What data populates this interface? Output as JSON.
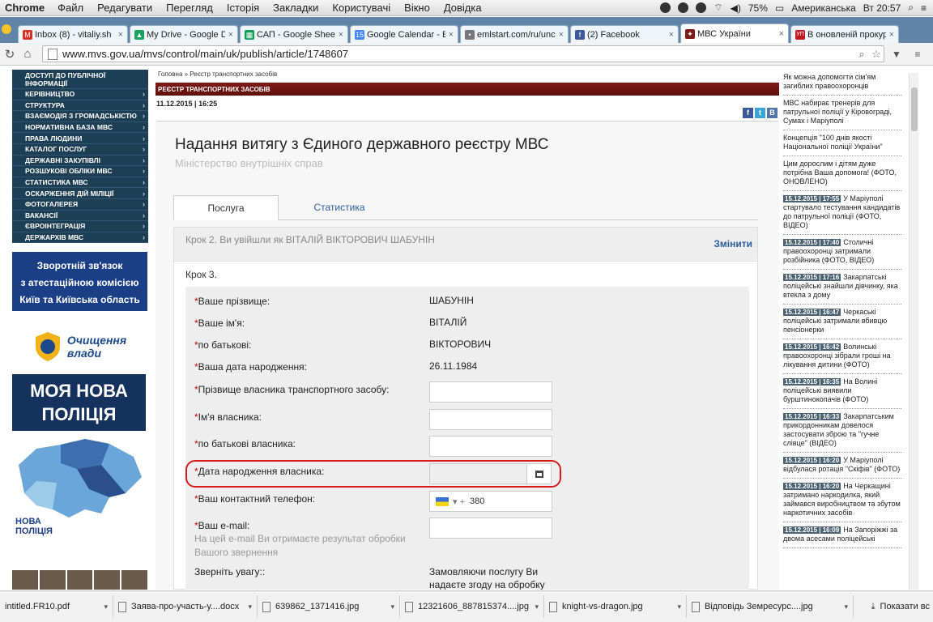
{
  "os": {
    "app": "Chrome",
    "menu": [
      "Файл",
      "Редагувати",
      "Перегляд",
      "Історія",
      "Закладки",
      "Користувачі",
      "Вікно",
      "Довідка"
    ],
    "battery": "75%",
    "input_source": "Американська",
    "clock": "Вт 20:57"
  },
  "tabs": [
    {
      "label": "Inbox (8) - vitaliy.sh",
      "icon": "gmail-icon",
      "color": "#d93025",
      "glyph": "M"
    },
    {
      "label": "My Drive - Google D",
      "icon": "drive-icon",
      "color": "#1aa15f",
      "glyph": "▲"
    },
    {
      "label": "САП - Google Shee",
      "icon": "sheets-icon",
      "color": "#0f9d58",
      "glyph": "▦"
    },
    {
      "label": "Google Calendar - E",
      "icon": "calendar-icon",
      "color": "#4285f4",
      "glyph": "15"
    },
    {
      "label": "emlstart.com/ru/unc",
      "icon": "page-icon",
      "color": "#777",
      "glyph": "•"
    },
    {
      "label": "(2) Facebook",
      "icon": "facebook-icon",
      "color": "#3b5998",
      "glyph": "f"
    },
    {
      "label": "МВС України",
      "icon": "mvs-icon",
      "color": "#7f1b17",
      "glyph": "✦"
    },
    {
      "label": "В оновленій прокур",
      "icon": "up-icon",
      "color": "#c0161c",
      "glyph": "УП"
    }
  ],
  "address": {
    "url": "www.mvs.gov.ua/mvs/control/main/uk/publish/article/1748607"
  },
  "leftnav": [
    "ДОСТУП ДО ПУБЛІЧНОЇ ІНФОРМАЦІЇ",
    "КЕРІВНИЦТВО",
    "СТРУКТУРА",
    "ВЗАЄМОДІЯ З ГРОМАДСЬКІСТЮ",
    "НОРМАТИВНА БАЗА МВС",
    "ПРАВА ЛЮДИНИ",
    "КАТАЛОГ ПОСЛУГ",
    "ДЕРЖАВНІ ЗАКУПІВЛІ",
    "РОЗШУКОВІ ОБЛІКИ МВС",
    "СТАТИСТИКА МВС",
    "ОСКАРЖЕННЯ ДІЙ МІЛІЦІЇ",
    "ФОТОГАЛЕРЕЯ",
    "ВАКАНСІЇ",
    "ЄВРОІНТЕГРАЦІЯ",
    "ДЕРЖАРХІВ МВС"
  ],
  "banners": {
    "feedback1": "Зворотній зв'язок",
    "feedback2": "з атестаційною комісією",
    "feedback3": "Київ та Київська область",
    "clean1": "Очищення",
    "clean2": "влади",
    "police1": "МОЯ НОВА",
    "police2": "ПОЛІЦІЯ",
    "map1": "НОВА",
    "map2": "ПОЛІЦІЯ"
  },
  "page": {
    "breadcrumb": "Головна » Реєстр транспортних засобів",
    "section": "РЕЄСТР ТРАНСПОРТНИХ ЗАСОБІВ",
    "date": "11.12.2015 | 16:25",
    "title": "Надання витягу з Єдиного державного реєстру МВС",
    "subtitle": "Міністерство внутрішніх справ",
    "tab_service": "Послуга",
    "tab_stats": "Статистика",
    "step2": "Крок 2. Ви увійшли як ВІТАЛІЙ ВІКТОРОВИЧ ШАБУНІН",
    "change": "Змінити",
    "step3": "Крок 3."
  },
  "form": {
    "surname_label": "Ваше прізвище:",
    "surname": "ШАБУНІН",
    "name_label": "Ваше ім'я:",
    "name": "ВІТАЛІЙ",
    "patronymic_label": "по батькові:",
    "patronymic": "ВІКТОРОВИЧ",
    "dob_label": "Ваша дата народження:",
    "dob": "26.11.1984",
    "owner_surname_label": "Прізвище власника транспортного засобу:",
    "owner_name_label": "Ім'я власника:",
    "owner_patronymic_label": "по батькові власника:",
    "owner_dob_label": "Дата народження власника:",
    "phone_label": "Ваш контактний телефон:",
    "phone_prefix": "380",
    "email_label": "Ваш e-mail:",
    "email_hint": "На цей e-mail Ви отримаєте результат обробки Вашого звернення",
    "attention_label": "Зверніть увагу::",
    "attention_text": "Замовляючи послугу Ви надаєте згоду на обробку"
  },
  "news": [
    {
      "time": "",
      "text": "Як можна допомогти сім'ям загиблих правоохоронців"
    },
    {
      "time": "",
      "text": "МВС набирає тренерів для патрульної поліції у Кіровограді, Сумах і Маріуполі"
    },
    {
      "time": "",
      "text": "Концепція \"100 днів якості Національної поліції України\""
    },
    {
      "time": "",
      "text": "Цим дорослим і дітям дуже потрібна Ваша допомога! (ФОТО, ОНОВЛЕНО)"
    },
    {
      "time": "15.12.2015 | 17:55",
      "text": "У Маріуполі стартувало тестування кандидатів до патрульної поліції (ФОТО, ВІДЕО)"
    },
    {
      "time": "15.12.2015 | 17:40",
      "text": "Столичні правоохоронці затримали розбійника (ФОТО, ВІДЕО)"
    },
    {
      "time": "15.12.2015 | 17:16",
      "text": "Закарпатські поліцейські знайшли дівчинку, яка втекла з дому"
    },
    {
      "time": "15.12.2015 | 16:47",
      "text": "Черкаські поліцейські затримали вбивцю пенсіонерки"
    },
    {
      "time": "15.12.2015 | 16:42",
      "text": "Волинські правоохоронці зібрали гроші на лікування дитини (ФОТО)"
    },
    {
      "time": "15.12.2015 | 16:35",
      "text": "На Волині поліцейські виявили бурштинокопачів (ФОТО)"
    },
    {
      "time": "15.12.2015 | 16:33",
      "text": "Закарпатським прикордонникам довелося застосувати зброю та \"гучне слівце\" (ВІДЕО)"
    },
    {
      "time": "15.12.2015 | 16:20",
      "text": "У Маріуполі відбулася ротація \"Скіфів\" (ФОТО)"
    },
    {
      "time": "15.12.2015 | 16:20",
      "text": "На Черкащині затримано наркодилка, який займався виробництвом та збутом наркотичних засобів"
    },
    {
      "time": "15.12.2015 | 16:09",
      "text": "На Запоріжжі за двома асесами поліцейські"
    }
  ],
  "downloads": [
    {
      "name": "intitled.FR10.pdf",
      "w": 140
    },
    {
      "name": "Заява-про-участь-у....docx",
      "w": 178
    },
    {
      "name": "639862_1371416.jpg",
      "w": 176
    },
    {
      "name": "12321606_887815374....jpg",
      "w": 178
    },
    {
      "name": "knight-vs-dragon.jpg",
      "w": 176
    },
    {
      "name": "Відповідь Земресурс....jpg",
      "w": 206
    }
  ],
  "downloads_all": "Показати вс"
}
